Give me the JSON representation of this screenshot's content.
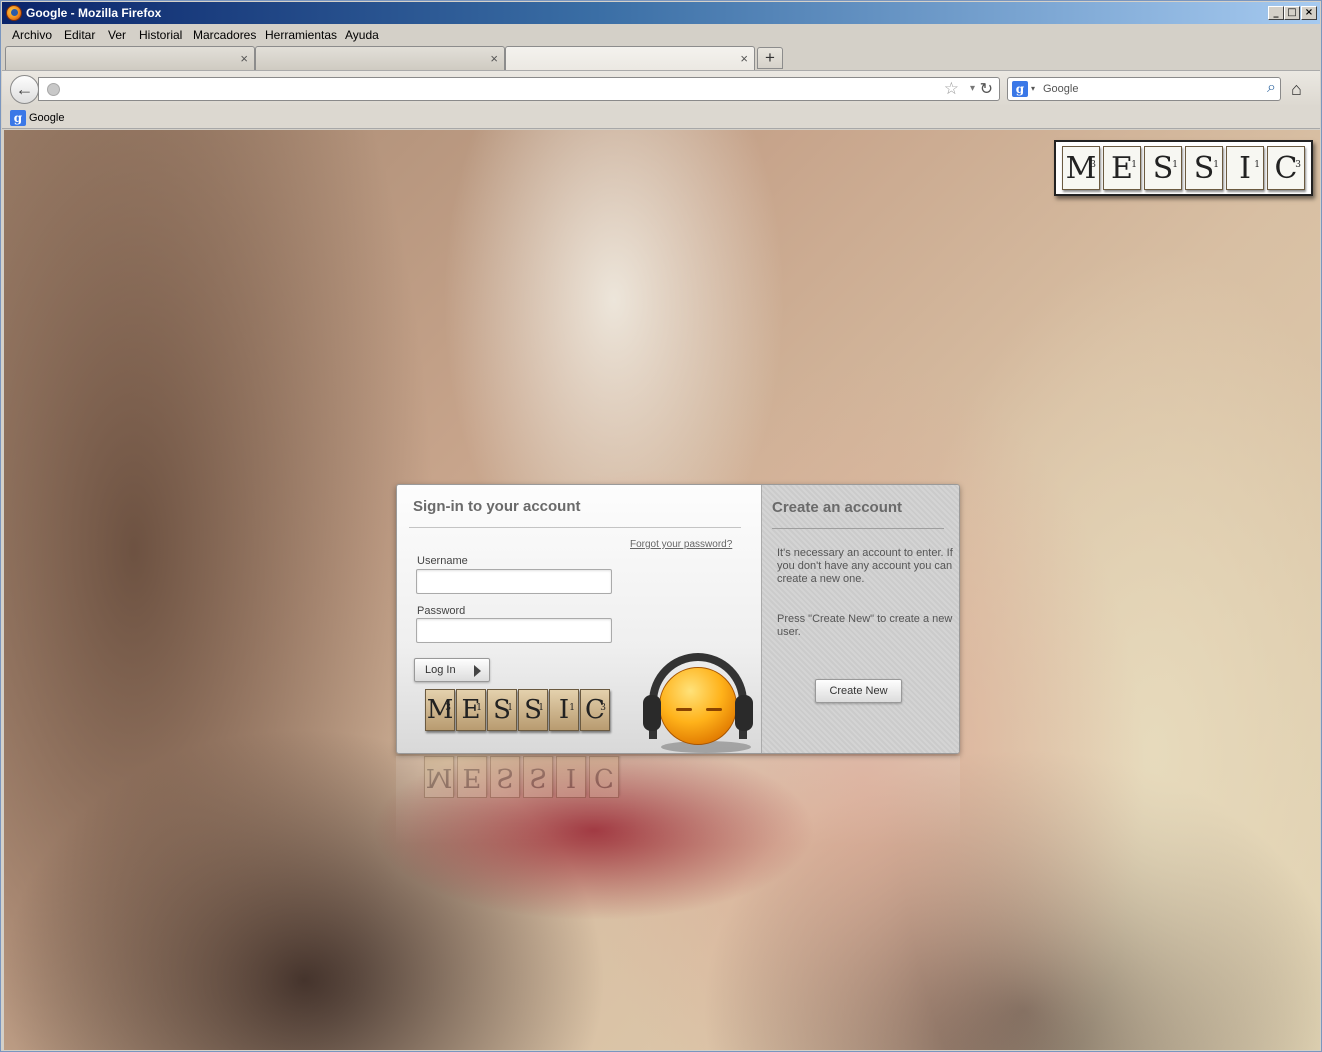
{
  "window": {
    "title": "Google - Mozilla Firefox",
    "buttons": {
      "minimize": "_",
      "maximize": "□",
      "close": "×"
    }
  },
  "menubar": {
    "items": [
      "Archivo",
      "Editar",
      "Ver",
      "Historial",
      "Marcadores",
      "Herramientas",
      "Ayuda"
    ]
  },
  "tabs": {
    "close_glyph": "×",
    "new_tab_glyph": "+"
  },
  "navbar": {
    "back_glyph": "←",
    "url_value": "",
    "star_glyph": "☆",
    "drop_glyph": "▾",
    "reload_glyph": "↻",
    "search_engine_glyph": "g",
    "search_placeholder": "Google",
    "search_icon": "magnifier-icon",
    "home_glyph": "⌂"
  },
  "bookmarks": {
    "items": [
      {
        "label": "Google",
        "icon": "google-icon"
      }
    ]
  },
  "logo": {
    "tiles": [
      {
        "letter": "M",
        "score": "3"
      },
      {
        "letter": "E",
        "score": "1"
      },
      {
        "letter": "S",
        "score": "1"
      },
      {
        "letter": "S",
        "score": "1"
      },
      {
        "letter": "I",
        "score": "1"
      },
      {
        "letter": "C",
        "score": "3"
      }
    ]
  },
  "signin": {
    "title": "Sign-in to your account",
    "forgot_link": "Forgot your password?",
    "username_label": "Username",
    "username_value": "",
    "password_label": "Password",
    "password_value": "",
    "login_button": "Log In"
  },
  "create": {
    "title": "Create an account",
    "text1": "It's necessary an account to enter.  If you don't have any account you can create a new one.",
    "text2": "Press \"Create New\" to create a new user.",
    "button": "Create New"
  },
  "colors": {
    "titlebar_start": "#0a246a",
    "titlebar_end": "#a6caf0",
    "panel_title": "#6a6a6a",
    "mascot_orange": "#ffb21a"
  }
}
